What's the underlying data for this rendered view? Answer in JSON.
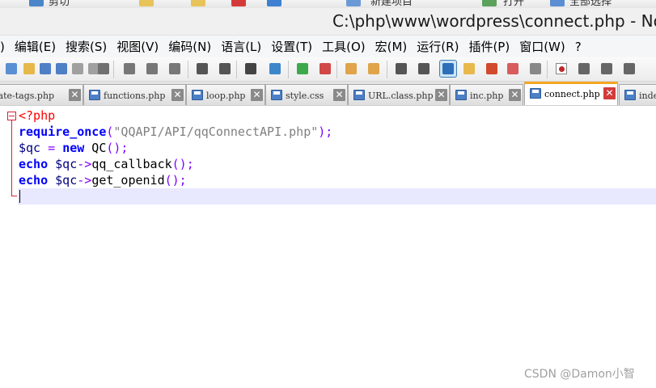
{
  "top_strip": {
    "left_label": "剪切",
    "mid_label_1": "新建项目",
    "mid_label_2": "打开",
    "right_label": "全部选择"
  },
  "window": {
    "title": "C:\\php\\www\\wordpress\\connect.php - Note"
  },
  "menu": {
    "items": [
      {
        "label": ")"
      },
      {
        "label": "编辑(E)"
      },
      {
        "label": "搜索(S)"
      },
      {
        "label": "视图(V)"
      },
      {
        "label": "编码(N)"
      },
      {
        "label": "语言(L)"
      },
      {
        "label": "设置(T)"
      },
      {
        "label": "工具(O)"
      },
      {
        "label": "宏(M)"
      },
      {
        "label": "运行(R)"
      },
      {
        "label": "插件(P)"
      },
      {
        "label": "窗口(W)"
      },
      {
        "label": "?"
      }
    ]
  },
  "toolbar": {
    "icons": [
      "new-file-icon",
      "open-file-icon",
      "save-icon",
      "save-all-icon",
      "close-icon",
      "close-all-icon",
      "print-icon",
      "cut-icon",
      "copy-icon",
      "paste-icon",
      "undo-icon",
      "redo-icon",
      "find-icon",
      "replace-icon",
      "zoom-in-icon",
      "zoom-out-icon",
      "sync-vertical-icon",
      "sync-horizontal-icon",
      "word-wrap-icon",
      "show-all-chars-icon",
      "indent-guide-icon",
      "document-map-icon",
      "function-list-icon",
      "folder-workspace-icon",
      "monitoring-icon",
      "record-macro-icon",
      "stop-macro-icon",
      "play-macro-icon",
      "run-macro-icon"
    ],
    "active_icon": "indent-guide-icon"
  },
  "tabs": [
    {
      "name": "plate-tags.php",
      "active": false
    },
    {
      "name": "functions.php",
      "active": false
    },
    {
      "name": "loop.php",
      "active": false
    },
    {
      "name": "style.css",
      "active": false
    },
    {
      "name": "URL.class.php",
      "active": false
    },
    {
      "name": "inc.php",
      "active": false
    },
    {
      "name": "connect.php",
      "active": true
    },
    {
      "name": "inde",
      "active": false
    }
  ],
  "editor": {
    "lines": [
      {
        "parts": [
          {
            "text": "<?php",
            "cls": "tag"
          }
        ]
      },
      {
        "parts": [
          {
            "text": "require_once",
            "cls": "k"
          },
          {
            "text": "(",
            "cls": "o"
          },
          {
            "text": "\"QQAPI/API/qqConnectAPI.php\"",
            "cls": "s"
          },
          {
            "text": ");",
            "cls": "o"
          }
        ]
      },
      {
        "parts": [
          {
            "text": "$qc",
            "cls": "v"
          },
          {
            "text": " ",
            "cls": "t"
          },
          {
            "text": "=",
            "cls": "o"
          },
          {
            "text": " ",
            "cls": "t"
          },
          {
            "text": "new",
            "cls": "k"
          },
          {
            "text": " QC",
            "cls": "t"
          },
          {
            "text": "();",
            "cls": "o"
          }
        ]
      },
      {
        "parts": [
          {
            "text": "echo",
            "cls": "k"
          },
          {
            "text": " ",
            "cls": "t"
          },
          {
            "text": "$qc",
            "cls": "v"
          },
          {
            "text": "->",
            "cls": "o"
          },
          {
            "text": "qq_callback",
            "cls": "t"
          },
          {
            "text": "();",
            "cls": "o"
          }
        ]
      },
      {
        "parts": [
          {
            "text": "echo",
            "cls": "k"
          },
          {
            "text": " ",
            "cls": "t"
          },
          {
            "text": "$qc",
            "cls": "v"
          },
          {
            "text": "->",
            "cls": "o"
          },
          {
            "text": "get_openid",
            "cls": "t"
          },
          {
            "text": "();",
            "cls": "o"
          }
        ]
      },
      {
        "parts": [
          {
            "text": "",
            "cls": "t"
          }
        ]
      }
    ]
  },
  "watermark": "CSDN @Damon小智",
  "colors": {
    "keyword": "#0000ff",
    "string": "#808080",
    "variable": "#000080",
    "operator": "#8000ff",
    "php_tag": "#ff0000",
    "active_tab_accent": "#f5a623",
    "current_line": "#e8e8ff"
  }
}
